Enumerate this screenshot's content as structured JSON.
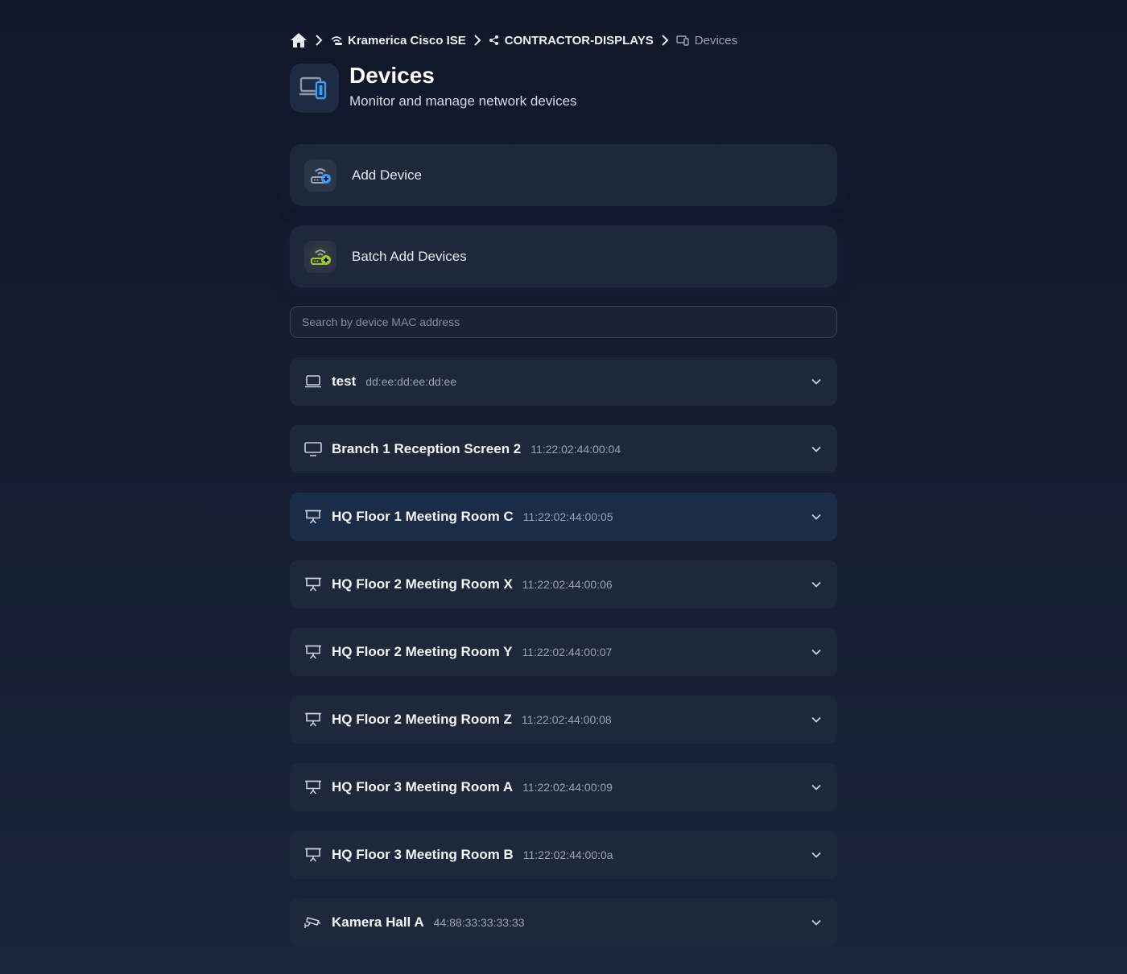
{
  "breadcrumb": {
    "org": "Kramerica Cisco ISE",
    "group": "CONTRACTOR-DISPLAYS",
    "current": "Devices"
  },
  "header": {
    "title": "Devices",
    "subtitle": "Monitor and manage network devices"
  },
  "actions": {
    "add_label": "Add Device",
    "batch_label": "Batch Add Devices"
  },
  "search": {
    "placeholder": "Search by device MAC address",
    "value": ""
  },
  "colors": {
    "accent_blue": "#3b9cf0",
    "accent_green": "#9cc832",
    "active_row": "#1b2c47"
  },
  "devices": [
    {
      "icon": "laptop-icon",
      "name": "test",
      "mac": "dd:ee:dd:ee:dd:ee"
    },
    {
      "icon": "monitor-icon",
      "name": "Branch 1 Reception Screen 2",
      "mac": "11:22:02:44:00:04"
    },
    {
      "icon": "presentation-screen-icon",
      "name": "HQ Floor 1 Meeting Room C",
      "mac": "11:22:02:44:00:05",
      "active": true
    },
    {
      "icon": "presentation-screen-icon",
      "name": "HQ Floor 2 Meeting Room X",
      "mac": "11:22:02:44:00:06"
    },
    {
      "icon": "presentation-screen-icon",
      "name": "HQ Floor 2 Meeting Room Y",
      "mac": "11:22:02:44:00:07"
    },
    {
      "icon": "presentation-screen-icon",
      "name": "HQ Floor 2 Meeting Room Z",
      "mac": "11:22:02:44:00:08"
    },
    {
      "icon": "presentation-screen-icon",
      "name": "HQ Floor 3 Meeting Room A",
      "mac": "11:22:02:44:00:09"
    },
    {
      "icon": "presentation-screen-icon",
      "name": "HQ Floor 3 Meeting Room B",
      "mac": "11:22:02:44:00:0a"
    },
    {
      "icon": "security-camera-icon",
      "name": "Kamera Hall A",
      "mac": "44:88:33:33:33:33"
    }
  ]
}
